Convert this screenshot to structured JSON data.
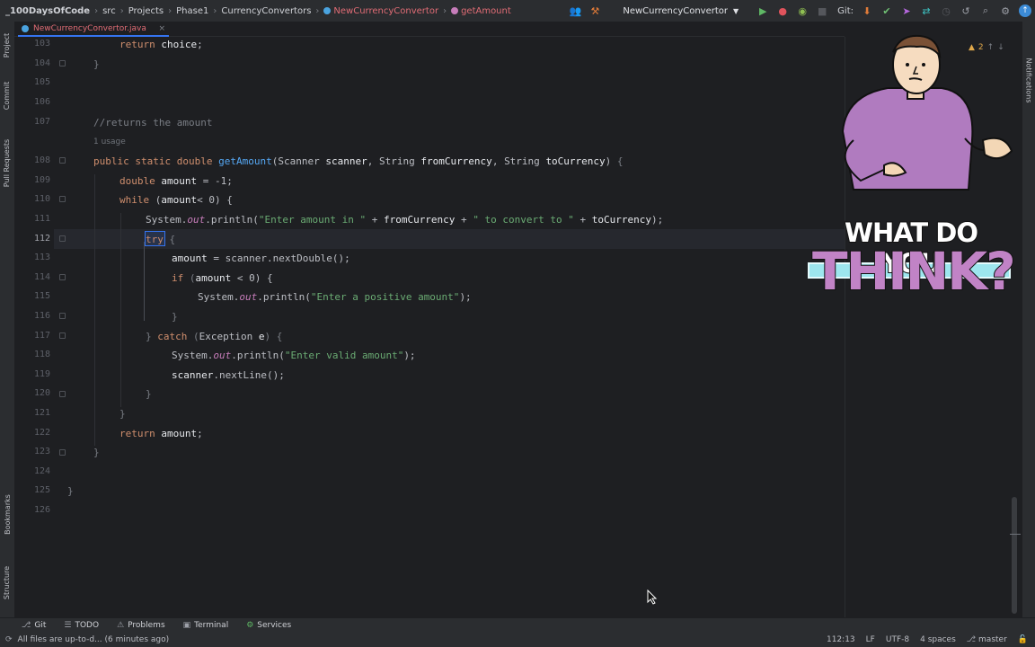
{
  "breadcrumbs": [
    "_100DaysOfCode",
    "src",
    "Projects",
    "Phase1",
    "CurrencyConvertors",
    "NewCurrencyConvertor",
    "getAmount"
  ],
  "run_config": "NewCurrencyConvertor",
  "git_label": "Git:",
  "open_tab": "NewCurrencyConvertor.java",
  "left_tool_tabs": [
    "Project",
    "Commit",
    "Pull Requests",
    "Bookmarks",
    "Structure"
  ],
  "right_tool_tabs": [
    "Notifications"
  ],
  "inspection_count": "2",
  "line_numbers": [
    "103",
    "104",
    "105",
    "106",
    "107",
    "",
    "108",
    "109",
    "110",
    "111",
    "112",
    "113",
    "114",
    "115",
    "116",
    "117",
    "118",
    "119",
    "120",
    "121",
    "122",
    "123",
    "124",
    "125",
    "126"
  ],
  "current_line": "112",
  "code": {
    "l103": {
      "kw": "return",
      "var": "choice",
      "end": ";"
    },
    "l107": "//returns the amount",
    "usage_hint": "1 usage",
    "l108": {
      "kw1": "public",
      "kw2": "static",
      "kw3": "double",
      "fn": "getAmount",
      "p1t": "Scanner",
      "p1": "scanner",
      "p2t": "String",
      "p2": "fromCurrency",
      "p3t": "String",
      "p3": "toCurrency"
    },
    "l109": {
      "kw": "double",
      "var": "amount",
      "rest": " = -1;"
    },
    "l110": {
      "kw": "while",
      "var": "amount",
      "rest": "< 0) {"
    },
    "l111": {
      "cls": "System",
      "fld": "out",
      "fn": "println",
      "s1": "\"Enter amount in \"",
      "v1": "fromCurrency",
      "s2": "\" to convert to \"",
      "v2": "toCurrency"
    },
    "l112": {
      "kw": "try",
      "rest": " {"
    },
    "l113": {
      "var": "amount",
      "rest": " = scanner.",
      "fn": "nextDouble",
      "end": "();"
    },
    "l114": {
      "kw": "if",
      "var": "amount",
      "rest": " < 0) {"
    },
    "l115": {
      "cls": "System",
      "fld": "out",
      "fn": "println",
      "s1": "\"Enter a positive amount\""
    },
    "l117": {
      "kw": "catch",
      "cls": "Exception",
      "var": "e"
    },
    "l118": {
      "cls": "System",
      "fld": "out",
      "fn": "println",
      "s1": "\"Enter valid amount\""
    },
    "l119": {
      "var": "scanner",
      "fn": "nextLine",
      "end": "();"
    },
    "l122": {
      "kw": "return",
      "var": "amount",
      "end": ";"
    }
  },
  "sticker": {
    "line1": "WHAT DO YOU",
    "line2": "THINK?"
  },
  "bottom_tools": [
    {
      "label": "Git",
      "icon": "git-branch-icon"
    },
    {
      "label": "TODO",
      "icon": "todo-icon"
    },
    {
      "label": "Problems",
      "icon": "problems-icon"
    },
    {
      "label": "Terminal",
      "icon": "terminal-icon"
    },
    {
      "label": "Services",
      "icon": "services-icon"
    }
  ],
  "status": {
    "message": "All files are up-to-d... (6 minutes ago)",
    "position": "112:13",
    "line_sep": "LF",
    "encoding": "UTF-8",
    "indent": "4 spaces",
    "branch": "master"
  }
}
